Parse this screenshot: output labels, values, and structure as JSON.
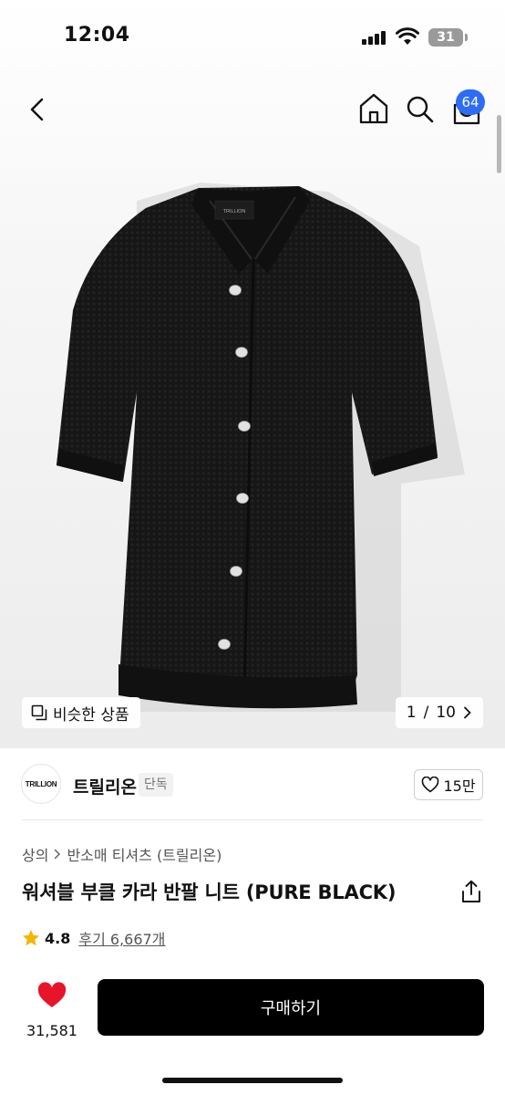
{
  "status": {
    "time": "12:04",
    "battery": "31"
  },
  "header": {
    "cart_count": "64"
  },
  "gallery": {
    "similar_label": "비슷한 상품",
    "page_current": "1",
    "page_separator": "/",
    "page_total": "10",
    "shirt_logo": "TRILLION"
  },
  "brand": {
    "logo_text": "TRILLION",
    "name": "트릴리온",
    "tag": "단독",
    "likes": "15만"
  },
  "product": {
    "category": "상의",
    "subcategory": "반소매 티셔츠 (트릴리온)",
    "title": "워셔블 부클 카라 반팔 니트 (PURE BLACK)",
    "rating": "4.8",
    "reviews": "후기 6,667개"
  },
  "bottom": {
    "wish_count": "31,581",
    "buy_label": "구매하기"
  },
  "colors": {
    "accent_badge": "#2d6cf6",
    "star": "#f5b400",
    "heart": "#e8152a",
    "buy_button": "#000000"
  }
}
